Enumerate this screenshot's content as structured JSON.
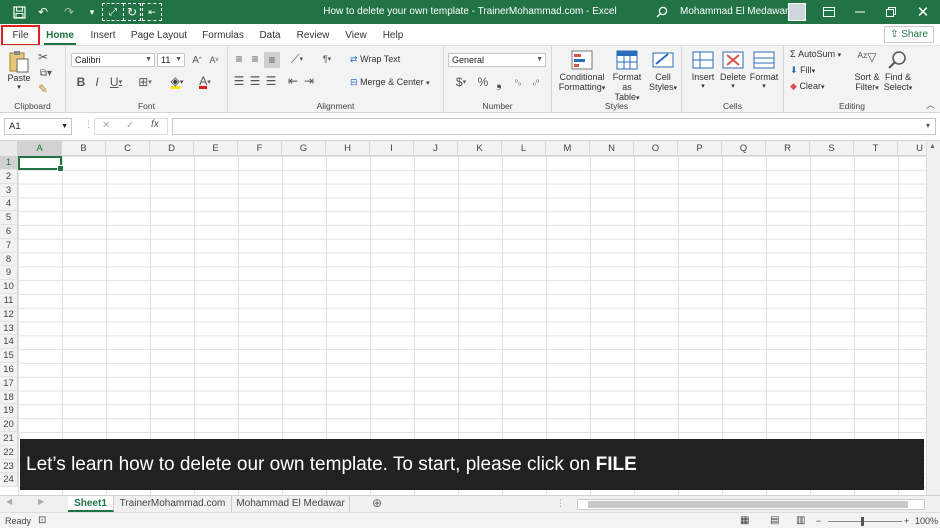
{
  "app": {
    "window_title": "How to delete your own template - TrainerMohammad.com  -  Excel",
    "user_name": "Mohammad El Medawar",
    "accent_color": "#217346"
  },
  "qat": {
    "icons": [
      "save-icon",
      "undo-icon",
      "redo-icon",
      "customize-icon",
      "fullscreen-icon",
      "refresh-icon",
      "touch-mode-icon"
    ]
  },
  "window_controls": {
    "icons": [
      "search-icon",
      "ribbon-display-icon",
      "minimize-icon",
      "restore-icon",
      "close-icon"
    ]
  },
  "tabs": [
    {
      "label": "File"
    },
    {
      "label": "Home"
    },
    {
      "label": "Insert"
    },
    {
      "label": "Page Layout"
    },
    {
      "label": "Formulas"
    },
    {
      "label": "Data"
    },
    {
      "label": "Review"
    },
    {
      "label": "View"
    },
    {
      "label": "Help"
    }
  ],
  "share_label": "Share",
  "ribbon": {
    "clipboard": {
      "label": "Clipboard",
      "paste": "Paste"
    },
    "font": {
      "label": "Font",
      "font_name": "Calibri",
      "font_size": "11"
    },
    "alignment": {
      "label": "Alignment",
      "wrap_text": "Wrap Text",
      "merge_center": "Merge & Center"
    },
    "number": {
      "label": "Number",
      "format": "General"
    },
    "styles": {
      "label": "Styles",
      "conditional_1": "Conditional",
      "conditional_2": "Formatting",
      "format_table_1": "Format as",
      "format_table_2": "Table",
      "cell_styles_1": "Cell",
      "cell_styles_2": "Styles"
    },
    "cells": {
      "label": "Cells",
      "insert": "Insert",
      "delete": "Delete",
      "format": "Format"
    },
    "editing": {
      "label": "Editing",
      "autosum": "AutoSum",
      "fill": "Fill",
      "clear": "Clear",
      "sort_1": "Sort &",
      "sort_2": "Filter",
      "find_1": "Find &",
      "find_2": "Select"
    }
  },
  "formula_bar": {
    "name_box": "A1",
    "fx": "fx",
    "cancel": "✕",
    "enter": "✓",
    "value": ""
  },
  "grid": {
    "columns": [
      "A",
      "B",
      "C",
      "D",
      "E",
      "F",
      "G",
      "H",
      "I",
      "J",
      "K",
      "L",
      "M",
      "N",
      "O",
      "P",
      "Q",
      "R",
      "S",
      "T",
      "U"
    ],
    "rows": [
      "1",
      "2",
      "3",
      "4",
      "5",
      "6",
      "7",
      "8",
      "9",
      "10",
      "11",
      "12",
      "13",
      "14",
      "15",
      "16",
      "17",
      "18",
      "19",
      "20",
      "21",
      "22",
      "23",
      "24"
    ],
    "selected_cell": "A1"
  },
  "caption": {
    "text": "Let’s learn how to delete our own template. To start, please click on ",
    "emphasis": "FILE"
  },
  "sheets": [
    {
      "label": "Sheet1",
      "active": true
    },
    {
      "label": "TrainerMohammad.com",
      "active": false
    },
    {
      "label": "Mohammad El Medawar",
      "active": false
    }
  ],
  "status": {
    "ready": "Ready",
    "zoom": "100%"
  }
}
